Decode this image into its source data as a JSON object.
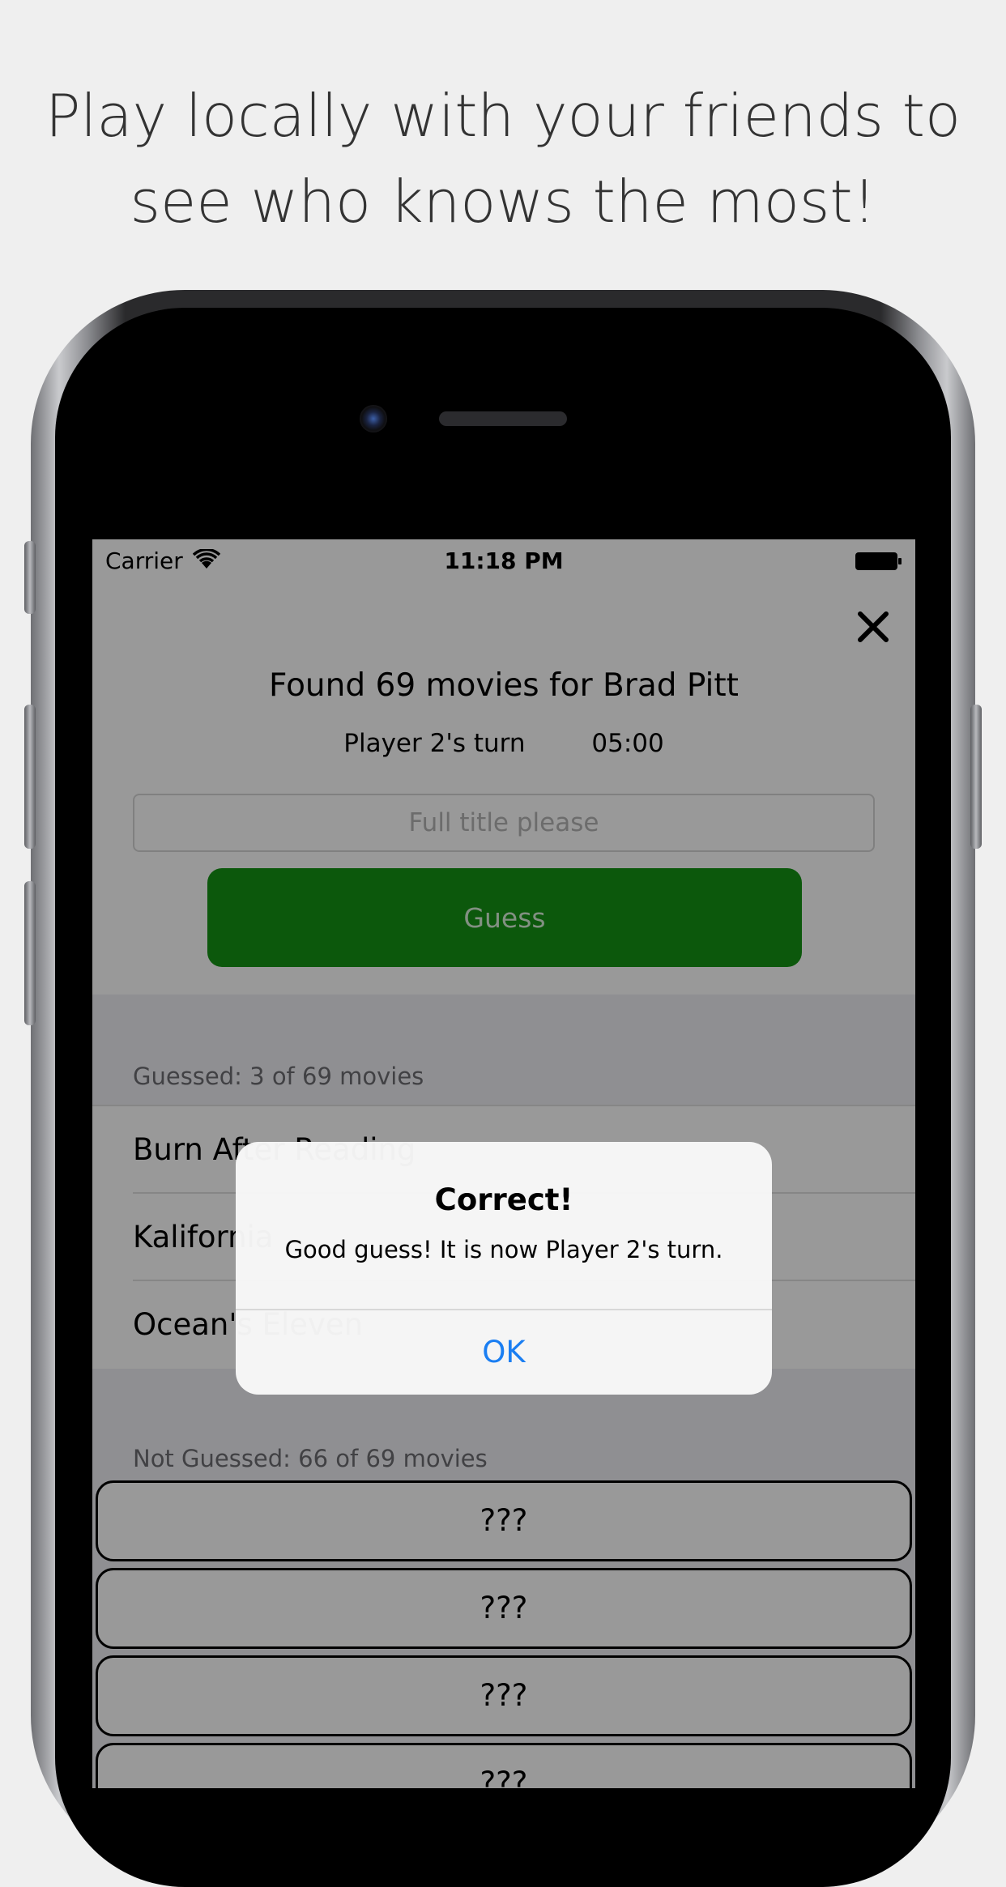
{
  "promo": {
    "line1": "Play locally with your friends to",
    "line2": "see who knows the most!"
  },
  "status_bar": {
    "carrier": "Carrier",
    "time": "11:18 PM"
  },
  "game": {
    "title": "Found 69 movies for Brad Pitt",
    "turn": "Player 2's turn",
    "timer": "05:00",
    "input_placeholder": "Full title please",
    "guess_label": "Guess",
    "accent_color": "#149314"
  },
  "guessed": {
    "header": "Guessed: 3 of 69 movies",
    "items": [
      "Burn After Reading",
      "Kalifornia",
      "Ocean's Eleven"
    ]
  },
  "not_guessed": {
    "header": "Not Guessed: 66 of 69 movies",
    "items": [
      "???",
      "???",
      "???",
      "???"
    ]
  },
  "alert": {
    "title": "Correct!",
    "message": "Good guess! It is now Player 2's turn.",
    "ok_label": "OK",
    "ok_color": "#1a7ef2"
  }
}
